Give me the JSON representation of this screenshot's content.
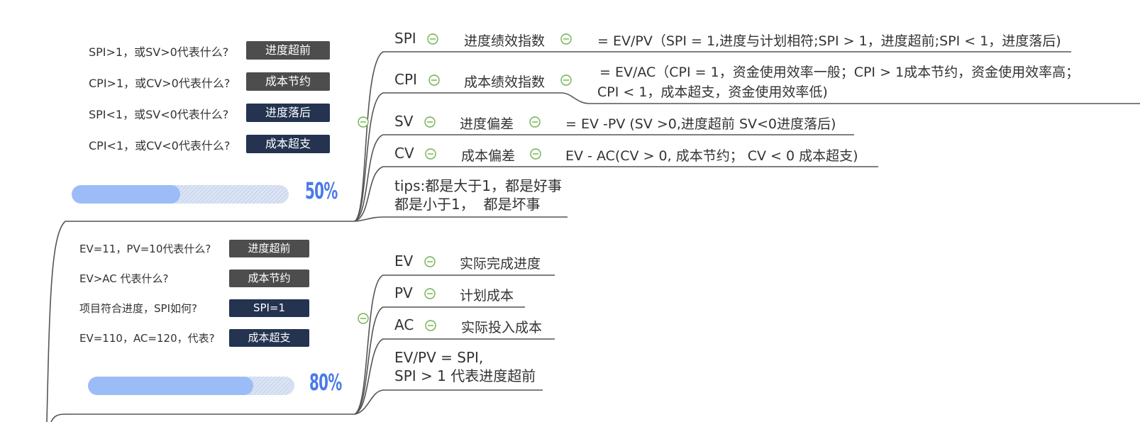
{
  "quiz1": {
    "questions": [
      {
        "q": "SPI>1，或SV>0代表什么?",
        "a": "进度超前",
        "style": "gray"
      },
      {
        "q": "CPI>1，或CV>0代表什么?",
        "a": "成本节约",
        "style": "gray"
      },
      {
        "q": "SPI<1，或SV<0代表什么?",
        "a": "进度落后",
        "style": "navy"
      },
      {
        "q": "CPI<1，或CV<0代表什么?",
        "a": "成本超支",
        "style": "navy"
      }
    ],
    "progress_label": "50%",
    "progress_value": 0.5
  },
  "quiz2": {
    "questions": [
      {
        "q": "EV=11，PV=10代表什么?",
        "a": "进度超前",
        "style": "gray"
      },
      {
        "q": "EV>AC 代表什么?",
        "a": "成本节约",
        "style": "gray"
      },
      {
        "q": "项目符合进度，SPI如何?",
        "a": "SPI=1",
        "style": "navy"
      },
      {
        "q": "EV=110，AC=120，代表?",
        "a": "成本超支",
        "style": "navy"
      }
    ],
    "progress_label": "80%",
    "progress_value": 0.8
  },
  "branch1": {
    "items": [
      {
        "key": "SPI",
        "name": "进度绩效指数",
        "desc": "= EV/PV（SPI = 1,进度与计划相符;SPI > 1，进度超前;SPI < 1，进度落后)"
      },
      {
        "key": "CPI",
        "name": "成本绩效指数",
        "desc": "= EV/AC（CPI = 1，资金使用效率一般；CPI > 1成本节约，资金使用效率高；",
        "desc2": "CPI < 1，成本超支，资金使用效率低)"
      },
      {
        "key": "SV",
        "name": "进度偏差",
        "desc": "= EV -PV (SV >0,进度超前  SV<0进度落后)"
      },
      {
        "key": "CV",
        "name": "成本偏差",
        "desc": "EV - AC(CV > 0, 成本节约；  CV < 0 成本超支)"
      }
    ],
    "tips": "tips:都是大于1，都是好事\n都是小于1，  都是坏事"
  },
  "branch2": {
    "items": [
      {
        "key": "EV",
        "name": "实际完成进度"
      },
      {
        "key": "PV",
        "name": "计划成本"
      },
      {
        "key": "AC",
        "name": "实际投入成本"
      }
    ],
    "note": "EV/PV = SPI,\nSPI > 1 代表进度超前"
  },
  "colors": {
    "line": "#555555",
    "collapse_green": "#6fb24a",
    "badge_gray": "#4d4d4d",
    "badge_navy": "#233350",
    "progress_fill": "#9cbcf8",
    "progress_text": "#4a7ae8"
  }
}
